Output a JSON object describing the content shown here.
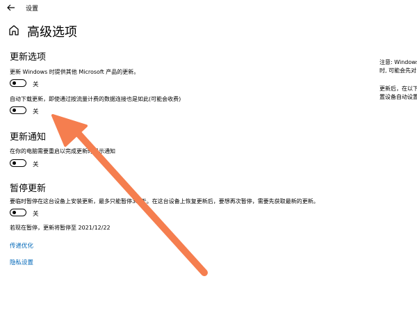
{
  "window": {
    "title": "设置"
  },
  "page": {
    "title": "高级选项"
  },
  "update_options": {
    "heading": "更新选项",
    "ms_products": {
      "description": "更新 Windows 时提供其他 Microsoft 产品的更新。",
      "state_label": "关",
      "checked": false
    },
    "metered_download": {
      "description": "自动下载更新，即使通过按流量计费的数据连接也是如此(可能会收费)",
      "state_label": "关",
      "checked": false
    }
  },
  "update_notifications": {
    "heading": "更新通知",
    "restart_notify": {
      "description": "在你的电脑需要重启以完成更新时显示通知",
      "state_label": "关",
      "checked": false
    }
  },
  "pause_updates": {
    "heading": "暂停更新",
    "pause_toggle": {
      "description": "要临时暂停在这台设备上安装更新，最多只能暂停35 天。在这台设备上恢复更新后，要想再次暂停，需要先获取最新的更新。",
      "state_label": "关",
      "checked": false
    },
    "pause_until_text": "若现在暂停，更新将暂停至 2021/12/22"
  },
  "links": {
    "delivery_optimization": "传递优化",
    "privacy_settings": "隐私设置"
  },
  "side_panel": {
    "note_line1": "注意: Windows",
    "note_line2": "时, 可能会先对",
    "after_line1": "更新后，在以下",
    "after_line2": "置设备自动设置"
  },
  "icons": {
    "back": "back-arrow-icon",
    "home": "home-icon"
  },
  "colors": {
    "link": "#0067b8",
    "annotation_arrow": "#f57e4f"
  }
}
